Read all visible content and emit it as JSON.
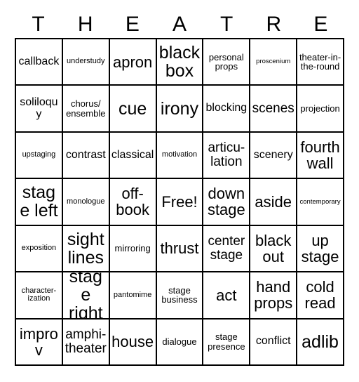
{
  "card": {
    "title_letters": [
      "T",
      "H",
      "E",
      "A",
      "T",
      "R",
      "E"
    ],
    "columns": 7,
    "rows": 7,
    "free_space_label": "Free!",
    "colors": {
      "background": "#ffffff",
      "border": "#000000",
      "text": "#000000"
    },
    "cells": [
      [
        {
          "text": "callback",
          "size": "md"
        },
        {
          "text": "understudy",
          "size": "xs"
        },
        {
          "text": "apron",
          "size": "xl"
        },
        {
          "text": "black box",
          "size": "xxl"
        },
        {
          "text": "personal props",
          "size": "sm"
        },
        {
          "text": "proscenium",
          "size": "xxs"
        },
        {
          "text": "theater-in-the-round",
          "size": "sm"
        }
      ],
      [
        {
          "text": "soliloquy",
          "size": "md"
        },
        {
          "text": "chorus/ ensemble",
          "size": "sm"
        },
        {
          "text": "cue",
          "size": "xxl"
        },
        {
          "text": "irony",
          "size": "xxl"
        },
        {
          "text": "blocking",
          "size": "md"
        },
        {
          "text": "scenes",
          "size": "lg"
        },
        {
          "text": "projection",
          "size": "sm"
        }
      ],
      [
        {
          "text": "upstaging",
          "size": "xs"
        },
        {
          "text": "contrast",
          "size": "md"
        },
        {
          "text": "classical",
          "size": "md"
        },
        {
          "text": "motivation",
          "size": "xs"
        },
        {
          "text": "articu-lation",
          "size": "lg"
        },
        {
          "text": "scenery",
          "size": "md"
        },
        {
          "text": "fourth wall",
          "size": "xl"
        }
      ],
      [
        {
          "text": "stage left",
          "size": "xxl"
        },
        {
          "text": "monologue",
          "size": "xs"
        },
        {
          "text": "off-book",
          "size": "xl"
        },
        {
          "text": "Free!",
          "size": "xl"
        },
        {
          "text": "down stage",
          "size": "xl"
        },
        {
          "text": "aside",
          "size": "xl"
        },
        {
          "text": "contemporary",
          "size": "xxs"
        }
      ],
      [
        {
          "text": "exposition",
          "size": "xs"
        },
        {
          "text": "sight lines",
          "size": "xxl"
        },
        {
          "text": "mirroring",
          "size": "sm"
        },
        {
          "text": "thrust",
          "size": "xl"
        },
        {
          "text": "center stage",
          "size": "lg"
        },
        {
          "text": "black out",
          "size": "xl"
        },
        {
          "text": "up stage",
          "size": "xl"
        }
      ],
      [
        {
          "text": "character-ization",
          "size": "xs"
        },
        {
          "text": "stage right",
          "size": "xxl"
        },
        {
          "text": "pantomime",
          "size": "xs"
        },
        {
          "text": "stage business",
          "size": "sm"
        },
        {
          "text": "act",
          "size": "xl"
        },
        {
          "text": "hand props",
          "size": "xl"
        },
        {
          "text": "cold read",
          "size": "xl"
        }
      ],
      [
        {
          "text": "improv",
          "size": "xl"
        },
        {
          "text": "amphi-theater",
          "size": "lg"
        },
        {
          "text": "house",
          "size": "xl"
        },
        {
          "text": "dialogue",
          "size": "sm"
        },
        {
          "text": "stage presence",
          "size": "sm"
        },
        {
          "text": "conflict",
          "size": "md"
        },
        {
          "text": "adlib",
          "size": "xxl"
        }
      ]
    ]
  }
}
